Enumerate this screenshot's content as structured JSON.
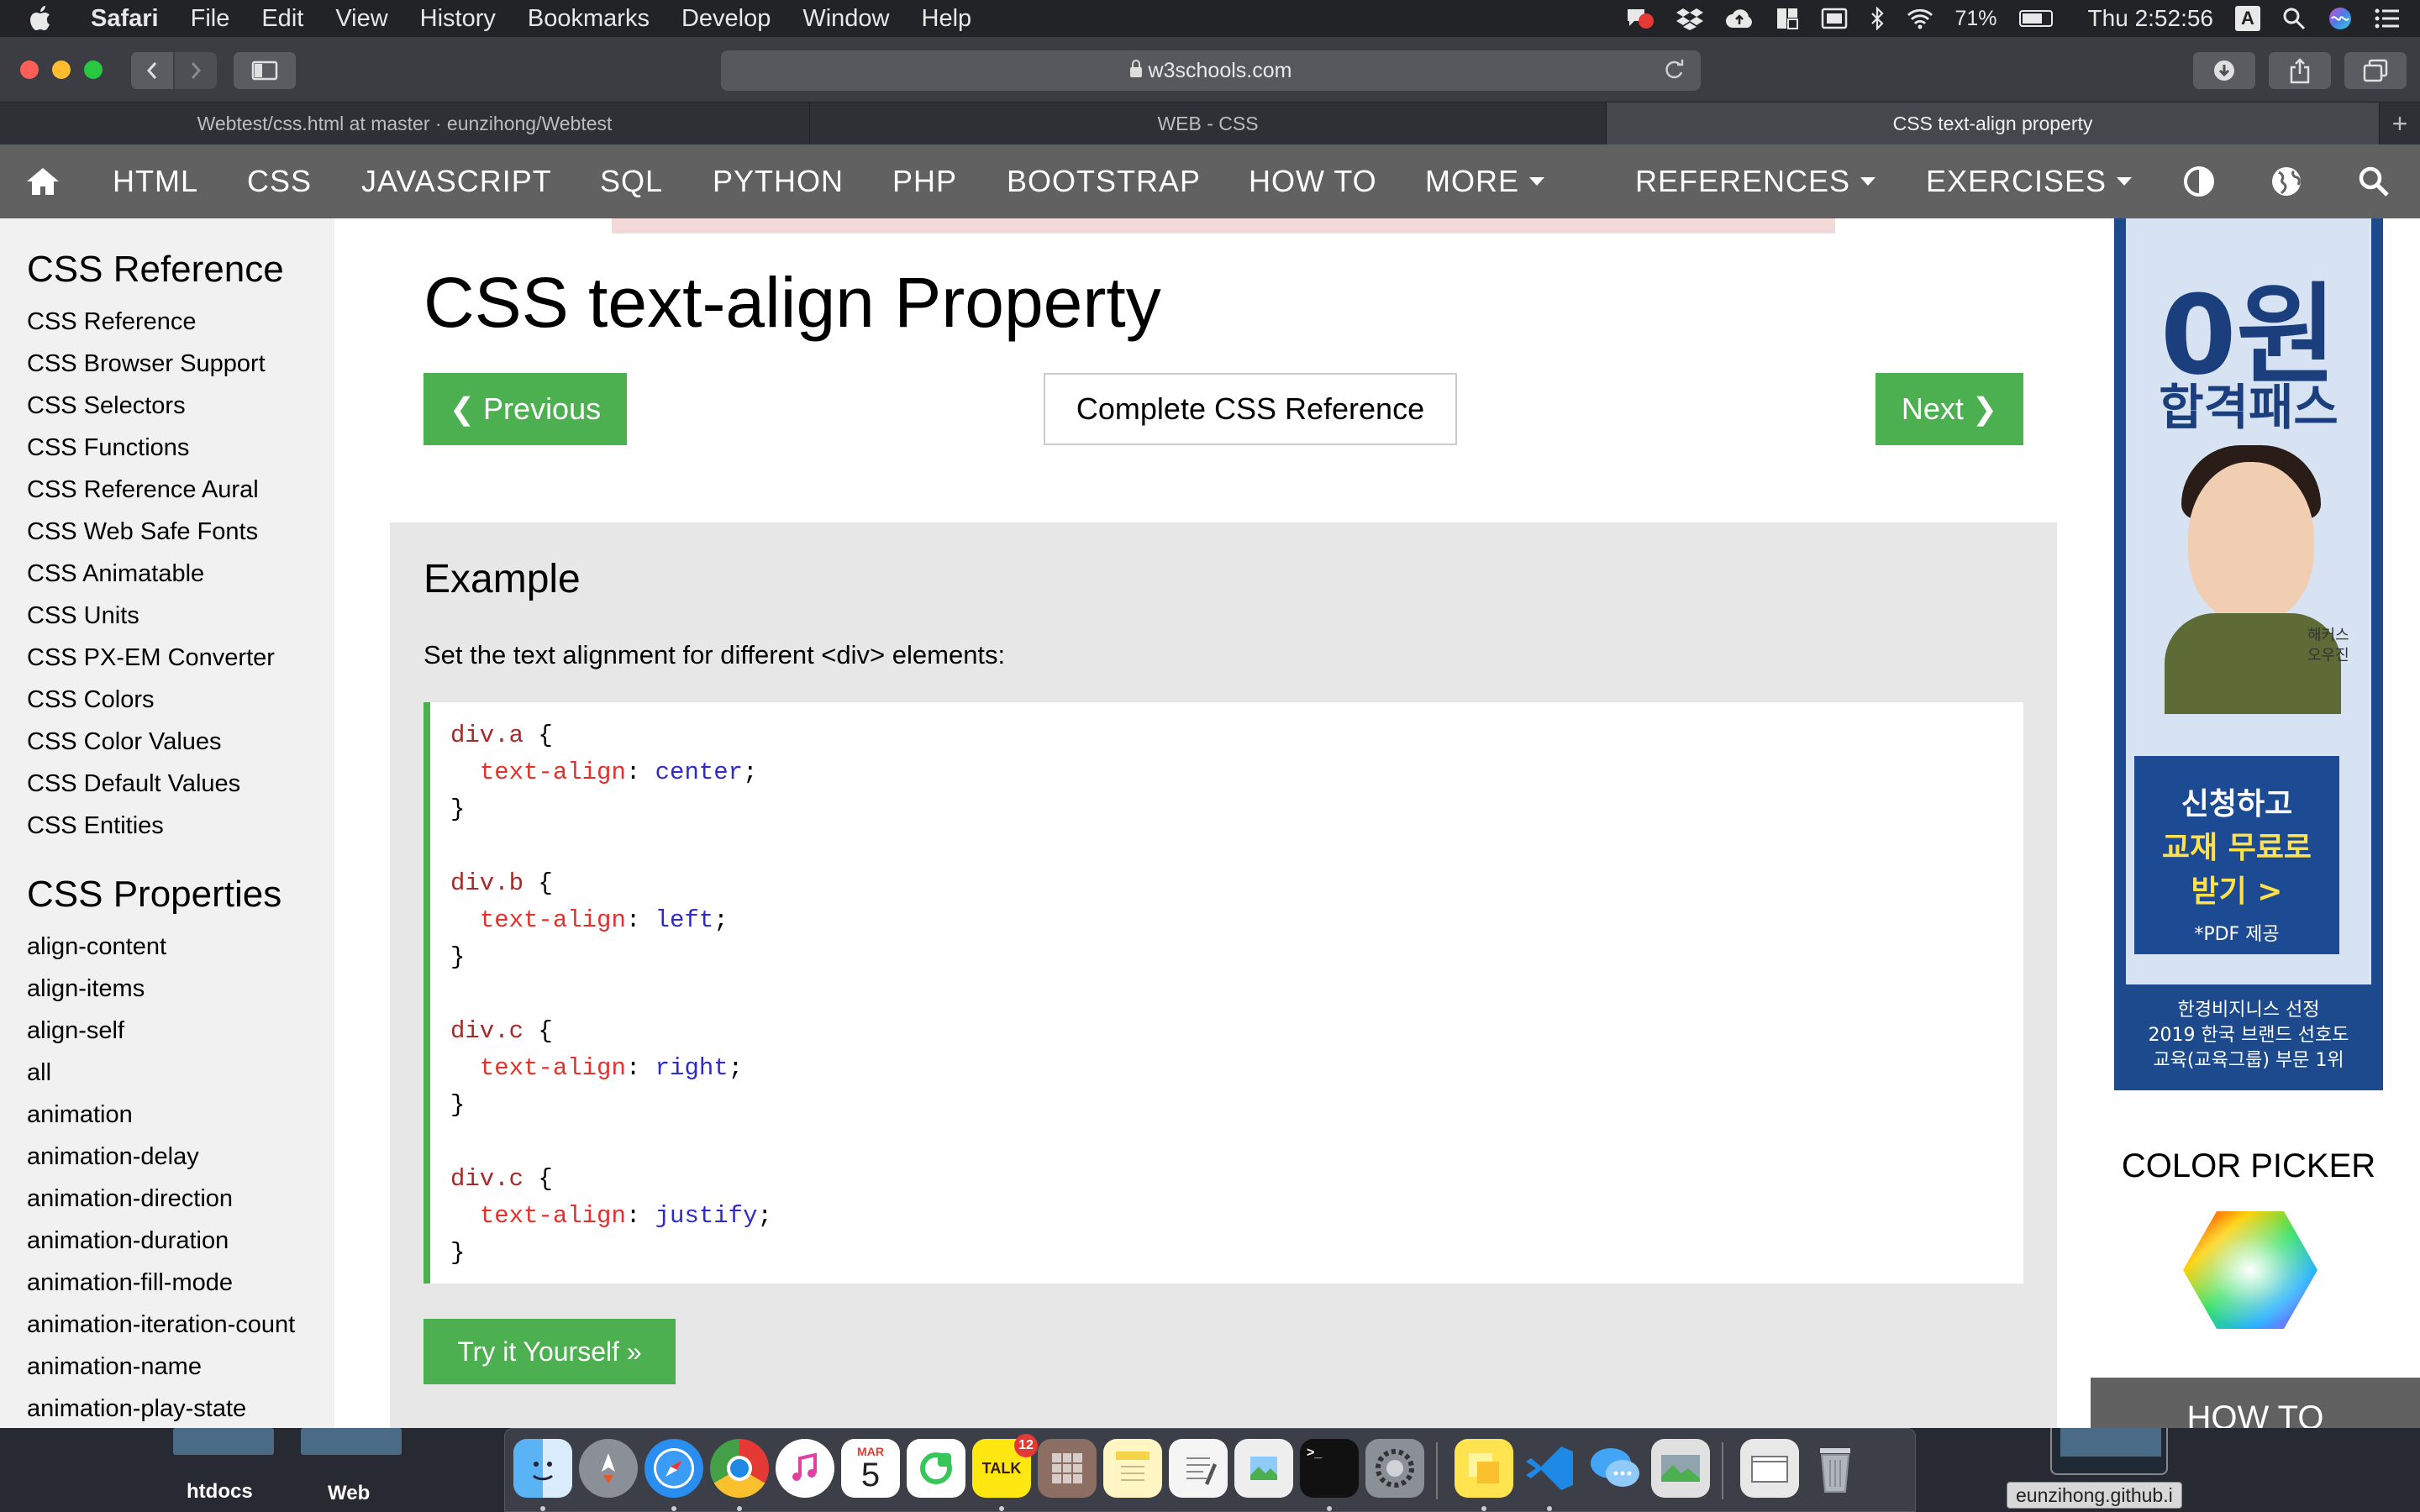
{
  "menubar": {
    "app": "Safari",
    "items": [
      "File",
      "Edit",
      "View",
      "History",
      "Bookmarks",
      "Develop",
      "Window",
      "Help"
    ],
    "battery_percent": "71%",
    "battery_level": 0.71,
    "clock": "Thu 2:52:56",
    "input_source": "A"
  },
  "browser": {
    "url": "w3schools.com",
    "tabs": [
      {
        "label": "Webtest/css.html at master · eunzihong/Webtest",
        "active": false
      },
      {
        "label": "WEB - CSS",
        "active": false
      },
      {
        "label": "CSS text-align property",
        "active": true
      }
    ],
    "new_tab": "+"
  },
  "w3nav": {
    "items": [
      "HTML",
      "CSS",
      "JAVASCRIPT",
      "SQL",
      "PYTHON",
      "PHP",
      "BOOTSTRAP",
      "HOW TO",
      "MORE",
      "REFERENCES",
      "EXERCISES"
    ]
  },
  "sidebar": {
    "section1_title": "CSS Reference",
    "section1_links": [
      "CSS Reference",
      "CSS Browser Support",
      "CSS Selectors",
      "CSS Functions",
      "CSS Reference Aural",
      "CSS Web Safe Fonts",
      "CSS Animatable",
      "CSS Units",
      "CSS PX-EM Converter",
      "CSS Colors",
      "CSS Color Values",
      "CSS Default Values",
      "CSS Entities"
    ],
    "section2_title": "CSS Properties",
    "section2_links": [
      "align-content",
      "align-items",
      "align-self",
      "all",
      "animation",
      "animation-delay",
      "animation-direction",
      "animation-duration",
      "animation-fill-mode",
      "animation-iteration-count",
      "animation-name",
      "animation-play-state"
    ]
  },
  "main": {
    "title": "CSS text-align Property",
    "prev_label": "❮ Previous",
    "reference_label": "Complete CSS Reference",
    "next_label": "Next ❯",
    "example_heading": "Example",
    "example_desc": "Set the text alignment for different <div> elements:",
    "code": [
      {
        "selector": "div.a",
        "property": "text-align",
        "value": "center"
      },
      {
        "selector": "div.b",
        "property": "text-align",
        "value": "left"
      },
      {
        "selector": "div.c",
        "property": "text-align",
        "value": "right"
      },
      {
        "selector": "div.c",
        "property": "text-align",
        "value": "justify"
      }
    ],
    "try_label": "Try it Yourself »"
  },
  "right_col": {
    "ad_lines": [
      "0원",
      "합격패스",
      "해커스",
      "오우진",
      "신청하고",
      "교재 무료로",
      "받기 >",
      "*PDF 제공",
      "한경비지니스 선정",
      "2019 한국 브랜드 선호도",
      "교육(교육그룹) 부문 1위"
    ],
    "color_picker_title": "COLOR PICKER",
    "howto_label": "HOW TO"
  },
  "desktop": {
    "folders": [
      "htdocs",
      "Web"
    ],
    "tooltip": "eunzihong.github.i"
  },
  "dock": {
    "calendar_month": "MAR",
    "calendar_day": "5",
    "kakao_label": "TALK",
    "kakao_badge": "12"
  },
  "colors": {
    "w3_green": "#4caf50",
    "w3_nav": "#616161",
    "code_selector": "#a52a2a",
    "code_property": "#e0322d",
    "code_value": "#2f2bc8"
  }
}
